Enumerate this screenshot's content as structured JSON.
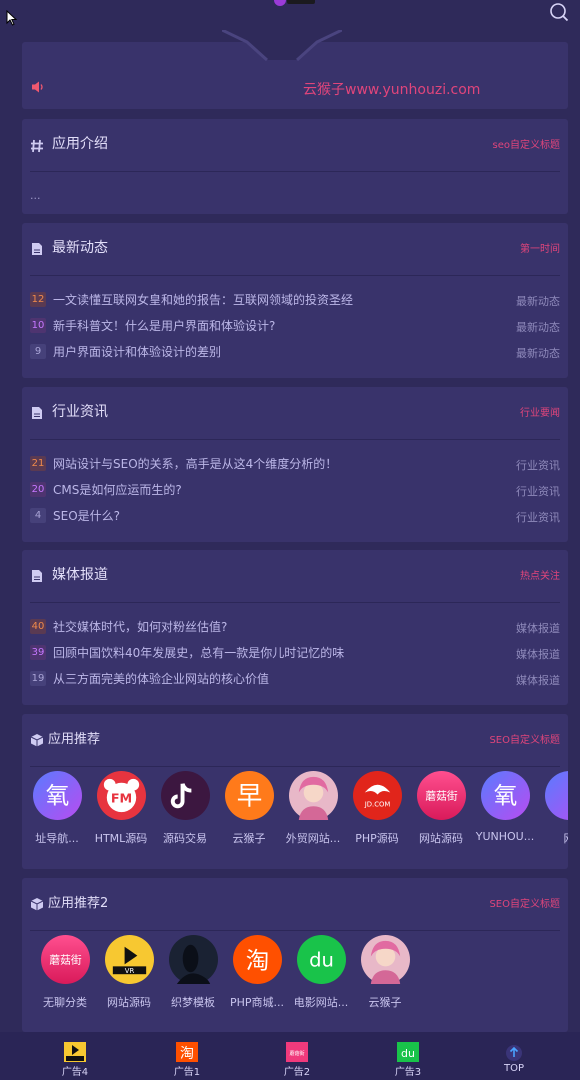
{
  "notice": {
    "text": "云猴子www.yunhouzi.com"
  },
  "intro": {
    "title": "应用介绍",
    "tag": "seo自定义标题",
    "content": "..."
  },
  "sections": [
    {
      "title": "最新动态",
      "tag": "第一时间",
      "items": [
        {
          "num": "12",
          "title": "一文读懂互联网女皇和她的报告：互联网领域的投资圣经",
          "cat": "最新动态"
        },
        {
          "num": "10",
          "title": "新手科普文！什么是用户界面和体验设计?",
          "cat": "最新动态"
        },
        {
          "num": "9",
          "title": "用户界面设计和体验设计的差别",
          "cat": "最新动态"
        }
      ]
    },
    {
      "title": "行业资讯",
      "tag": "行业要闻",
      "items": [
        {
          "num": "21",
          "title": "网站设计与SEO的关系，高手是从这4个维度分析的！",
          "cat": "行业资讯"
        },
        {
          "num": "20",
          "title": "CMS是如何应运而生的?",
          "cat": "行业资讯"
        },
        {
          "num": "4",
          "title": "SEO是什么?",
          "cat": "行业资讯"
        }
      ]
    },
    {
      "title": "媒体报道",
      "tag": "热点关注",
      "items": [
        {
          "num": "40",
          "title": "社交媒体时代，如何对粉丝估值?",
          "cat": "媒体报道"
        },
        {
          "num": "39",
          "title": "回顾中国饮料40年发展史，总有一款是你儿时记忆的味",
          "cat": "媒体报道"
        },
        {
          "num": "19",
          "title": "从三方面完美的体验企业网站的核心价值",
          "cat": "媒体报道"
        }
      ]
    }
  ],
  "apps1": {
    "title": "应用推荐",
    "tag": "SEO自定义标题",
    "items": [
      {
        "label": "址导航...",
        "icon": "oxygen-icon",
        "glyph": "氧"
      },
      {
        "label": "HTML源码",
        "icon": "fm-icon",
        "glyph": "FM"
      },
      {
        "label": "源码交易",
        "icon": "tiktok-icon",
        "glyph": "♪"
      },
      {
        "label": "云猴子",
        "icon": "hanzi-icon",
        "glyph": "早"
      },
      {
        "label": "外贸网站...",
        "icon": "avatar-icon",
        "glyph": ""
      },
      {
        "label": "PHP源码",
        "icon": "jd-icon",
        "glyph": "JD.COM"
      },
      {
        "label": "网站源码",
        "icon": "mogujie-icon",
        "glyph": "蘑菇街"
      },
      {
        "label": "YUNHOU...",
        "icon": "oxygen-icon",
        "glyph": "氧"
      },
      {
        "label": "网",
        "icon": "oxygen-icon",
        "glyph": ""
      }
    ]
  },
  "apps2": {
    "title": "应用推荐2",
    "tag": "SEO自定义标题",
    "items": [
      {
        "label": "无聊分类",
        "icon": "mogujie-icon",
        "glyph": "蘑菇街"
      },
      {
        "label": "网站源码",
        "icon": "vr-icon",
        "glyph": "VR"
      },
      {
        "label": "织梦模板",
        "icon": "silhouette-icon",
        "glyph": ""
      },
      {
        "label": "PHP商城...",
        "icon": "taobao-icon",
        "glyph": "淘"
      },
      {
        "label": "电影网站...",
        "icon": "du-icon",
        "glyph": "du"
      },
      {
        "label": "云猴子",
        "icon": "avatar-icon",
        "glyph": ""
      }
    ]
  },
  "bottom_tabs": [
    {
      "label": "广告4",
      "icon": "vr-tab-icon",
      "glyph": "VR"
    },
    {
      "label": "广告1",
      "icon": "taobao-tab-icon",
      "glyph": "淘"
    },
    {
      "label": "广告2",
      "icon": "mogujie-tab-icon",
      "glyph": "蘑菇街"
    },
    {
      "label": "广告3",
      "icon": "du-tab-icon",
      "glyph": "du"
    },
    {
      "label": "TOP",
      "icon": "arrow-up-icon",
      "glyph": "↑"
    }
  ],
  "colors": {
    "bg": "#2f2a5a",
    "card": "#39336b",
    "accent": "#e0457b"
  }
}
